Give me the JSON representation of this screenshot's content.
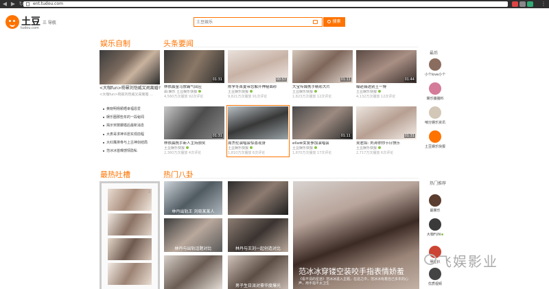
{
  "browser": {
    "url": "ent.tudou.com"
  },
  "header": {
    "logo_cn": "土豆",
    "logo_en": "tudou.com",
    "nav_label": "三 导航",
    "search_placeholder": "土豆娱乐",
    "search_button": "搜索"
  },
  "sections": {
    "yule_zizhi": "娱乐自制",
    "toutiao": "头条要闻",
    "zuire_tucao": "最热吐槽",
    "remen_bagua": "热门八卦"
  },
  "feature": {
    "caption": "<大咖fun>杨幂刘恺威又闹离婚?",
    "sub": "<大咖fun>杨幂刘恺威又闹离婚 …"
  },
  "bullets": [
    "黄晓明杨颖晒幸福恩爱",
    "娱乐圈那些年的一段秘闻",
    "揭示宋丽娜婚后最新消息",
    "大表哥求神许愿实现前程",
    "大红鹰排骨与上古神剑结局",
    "范冰冰首曝感情隐私"
  ],
  "cards": [
    {
      "title": "林依晨金马放霸气回应",
      "src": "由:娱乐 土豆娱乐快报",
      "stats": "4,560万次播放 92次评论",
      "dur": "01:31"
    },
    {
      "title": "陈学冬首夏带您解开神秘面纱",
      "src": "土豆娱乐快报",
      "stats": "9,821万次播放 91次评论",
      "dur": "00:57"
    },
    {
      "title": "大宝传媒携手精彩大片",
      "src": "土豆娱乐快报",
      "stats": "1,823万次播放 12次评论",
      "dur": "01:11"
    },
    {
      "title": "曝赵薇送别王一博",
      "src": "土豆娱乐快报",
      "stats": "4,132万次播放 12次评论",
      "dur": "01:44"
    },
    {
      "title": "刘诗诗吴奇隆恩爱现场",
      "src": "土豆娱乐快报",
      "stats": "1,824万次播放 16次评论",
      "dur": "01:31"
    },
    {
      "title": "林依晨携手新人主持颁奖",
      "src": "土豆娱乐快报",
      "stats": "2,360万次播放 4次评论",
      "dur": "01:31"
    },
    {
      "title": "周杰伦演唱会惊喜现身",
      "src": "土豆娱乐快报",
      "stats": "1,810万次播放 6次评论",
      "dur": ""
    },
    {
      "title": "ella带女友参加演唱会",
      "src": "土豆娱乐快报",
      "stats": "1,870万次播放 17次评论",
      "dur": "01:11"
    },
    {
      "title": "吴君如: 刘涛你你节日快乐",
      "src": "土豆娱乐快报",
      "stats": "2,717万次播放 6次评论",
      "dur": "01:31"
    }
  ],
  "sidebar": {
    "title_top": "最后",
    "top": [
      {
        "name": "小个love小个"
      },
      {
        "name": "娱乐播播料"
      },
      {
        "name": "咱分娱乐资讯"
      },
      {
        "name": "土豆娱乐快报"
      }
    ],
    "title_bottom": "热门推荐",
    "bottom": [
      {
        "name": "最娱乐"
      },
      {
        "name": "大咖FUN"
      },
      {
        "name": "明星扒"
      },
      {
        "name": "优质视频"
      }
    ]
  },
  "tucao_nums": [
    "1",
    "2",
    "3"
  ],
  "bagua": {
    "tile1_caption": "林丹出轨王 刘晓某某人",
    "tile2_caption": "",
    "tile3_caption": "林丹与出轨话题对比",
    "tile4_caption": "",
    "tile5_caption": "林丹与王刘一起创造对比",
    "tile6_caption": "男子生日派对豪华度爆光",
    "big_caption": "范冰冰穿镂空装咬手指表情娇羞",
    "big_sub": "《看不清的星途》范冰冰进入主题，在这之中，范冰冰有着自己多年的心声，用手指不太卫生"
  },
  "watermark": "飞娱影业"
}
